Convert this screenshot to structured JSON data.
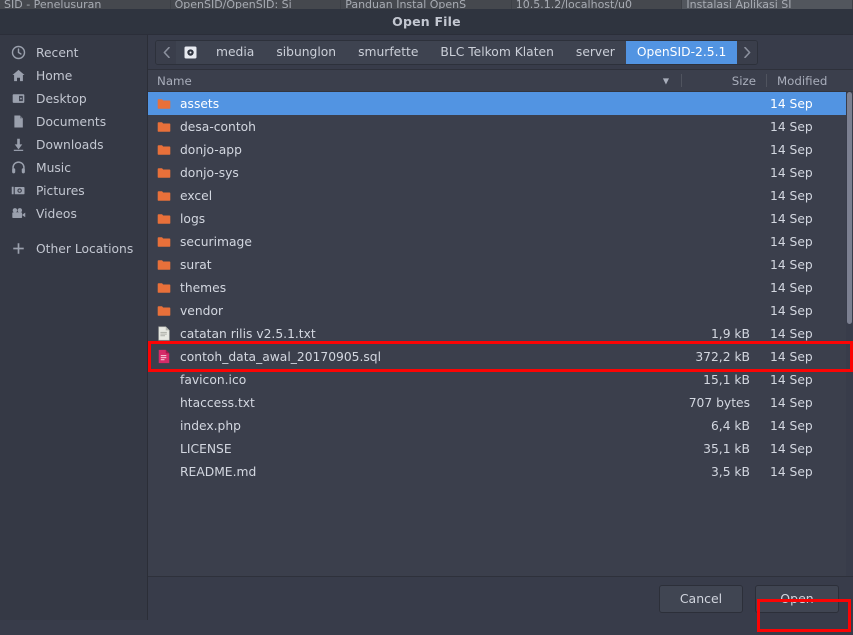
{
  "browser_tabstrip": {
    "tabs": [
      {
        "title": "SID - Penelusuran",
        "active": false
      },
      {
        "title": "OpenSID/OpenSID: Si",
        "active": false
      },
      {
        "title": "Panduan Instal OpenS",
        "active": false
      },
      {
        "title": "10.5.1.2/localhost/u0",
        "active": false
      },
      {
        "title": "Instalasi Aplikasi SI",
        "active": true
      }
    ]
  },
  "dialog": {
    "title": "Open File"
  },
  "sidebar": {
    "items": [
      {
        "label": "Recent",
        "icon": "clock-icon"
      },
      {
        "label": "Home",
        "icon": "home-icon"
      },
      {
        "label": "Desktop",
        "icon": "desktop-icon"
      },
      {
        "label": "Documents",
        "icon": "document-icon"
      },
      {
        "label": "Downloads",
        "icon": "download-icon"
      },
      {
        "label": "Music",
        "icon": "music-icon"
      },
      {
        "label": "Pictures",
        "icon": "pictures-icon"
      },
      {
        "label": "Videos",
        "icon": "videos-icon"
      }
    ],
    "other_locations": {
      "label": "Other Locations",
      "icon": "plus-icon"
    }
  },
  "pathbar": {
    "prev_icon": "chevron-left-icon",
    "next_icon": "chevron-right-icon",
    "device_icon": "media-drive-icon",
    "crumbs": [
      {
        "label": "media",
        "active": false
      },
      {
        "label": "sibunglon",
        "active": false
      },
      {
        "label": "smurfette",
        "active": false
      },
      {
        "label": "BLC Telkom Klaten",
        "active": false
      },
      {
        "label": "server",
        "active": false
      },
      {
        "label": "OpenSID-2.5.1",
        "active": true
      }
    ]
  },
  "columns": {
    "name": "Name",
    "size": "Size",
    "modified": "Modified",
    "sort_icon": "sort-descending-icon"
  },
  "files": [
    {
      "name": "assets",
      "size": "",
      "modified": "14 Sep",
      "type": "folder",
      "selected": true
    },
    {
      "name": "desa-contoh",
      "size": "",
      "modified": "14 Sep",
      "type": "folder",
      "selected": false
    },
    {
      "name": "donjo-app",
      "size": "",
      "modified": "14 Sep",
      "type": "folder",
      "selected": false
    },
    {
      "name": "donjo-sys",
      "size": "",
      "modified": "14 Sep",
      "type": "folder",
      "selected": false
    },
    {
      "name": "excel",
      "size": "",
      "modified": "14 Sep",
      "type": "folder",
      "selected": false
    },
    {
      "name": "logs",
      "size": "",
      "modified": "14 Sep",
      "type": "folder",
      "selected": false
    },
    {
      "name": "securimage",
      "size": "",
      "modified": "14 Sep",
      "type": "folder",
      "selected": false
    },
    {
      "name": "surat",
      "size": "",
      "modified": "14 Sep",
      "type": "folder",
      "selected": false
    },
    {
      "name": "themes",
      "size": "",
      "modified": "14 Sep",
      "type": "folder",
      "selected": false
    },
    {
      "name": "vendor",
      "size": "",
      "modified": "14 Sep",
      "type": "folder",
      "selected": false
    },
    {
      "name": "catatan rilis v2.5.1.txt",
      "size": "1,9 kB",
      "modified": "14 Sep",
      "type": "text",
      "selected": false
    },
    {
      "name": "contoh_data_awal_20170905.sql",
      "size": "372,2 kB",
      "modified": "14 Sep",
      "type": "sql",
      "selected": false
    },
    {
      "name": "favicon.ico",
      "size": "15,1 kB",
      "modified": "14 Sep",
      "type": "generic",
      "selected": false
    },
    {
      "name": "htaccess.txt",
      "size": "707 bytes",
      "modified": "14 Sep",
      "type": "generic",
      "selected": false
    },
    {
      "name": "index.php",
      "size": "6,4 kB",
      "modified": "14 Sep",
      "type": "generic",
      "selected": false
    },
    {
      "name": "LICENSE",
      "size": "35,1 kB",
      "modified": "14 Sep",
      "type": "generic",
      "selected": false
    },
    {
      "name": "README.md",
      "size": "3,5 kB",
      "modified": "14 Sep",
      "type": "generic",
      "selected": false
    }
  ],
  "footer": {
    "cancel_label": "Cancel",
    "open_label": "Open"
  },
  "colors": {
    "accent": "#5294e2",
    "folder": "#e8703a",
    "sql_icon": "#d62b68",
    "annotation": "#fb0404",
    "window_bg": "#383c4a",
    "list_bg": "#3b3f4c"
  }
}
